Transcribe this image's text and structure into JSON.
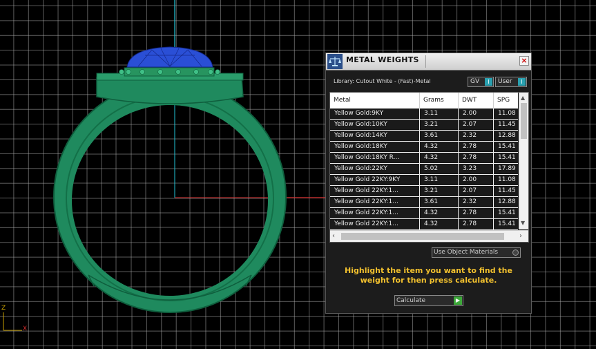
{
  "viewport": {
    "axis_labels": {
      "z": "Z",
      "x": "X"
    },
    "colors": {
      "ring": "#1f8a5e",
      "ring_dark": "#0f5e3d",
      "gem": "#2a4fd6",
      "y_axis": "#22c4d6",
      "x_axis": "#d42b2b"
    }
  },
  "panel": {
    "title": "METAL WEIGHTS",
    "close_label": "×",
    "library_label": "Library: Cutout White - (Fast)-Metal",
    "toggles": {
      "gv": "GV",
      "user": "User",
      "indicator": "I"
    },
    "table": {
      "columns": [
        "Metal",
        "Grams",
        "DWT",
        "SPG"
      ],
      "rows": [
        [
          "Yellow Gold:9KY",
          "3.11",
          "2.00",
          "11.08"
        ],
        [
          "Yellow Gold:10KY",
          "3.21",
          "2.07",
          "11.45"
        ],
        [
          "Yellow Gold:14KY",
          "3.61",
          "2.32",
          "12.88"
        ],
        [
          "Yellow Gold:18KY",
          "4.32",
          "2.78",
          "15.41"
        ],
        [
          "Yellow Gold:18KY R...",
          "4.32",
          "2.78",
          "15.41"
        ],
        [
          "Yellow Gold:22KY",
          "5.02",
          "3.23",
          "17.89"
        ],
        [
          "Yellow Gold 22KY:9KY",
          "3.11",
          "2.00",
          "11.08"
        ],
        [
          "Yellow Gold 22KY:1...",
          "3.21",
          "2.07",
          "11.45"
        ],
        [
          "Yellow Gold 22KY:1...",
          "3.61",
          "2.32",
          "12.88"
        ],
        [
          "Yellow Gold 22KY:1...",
          "4.32",
          "2.78",
          "15.41"
        ],
        [
          "Yellow Gold 22KY:1...",
          "4.32",
          "2.78",
          "15.41"
        ]
      ]
    },
    "use_object_materials": "Use Object Materials",
    "instructions": "Highlight the item you want to find the weight for then press calculate.",
    "calculate_label": "Calculate",
    "calculate_indicator": "▶"
  }
}
